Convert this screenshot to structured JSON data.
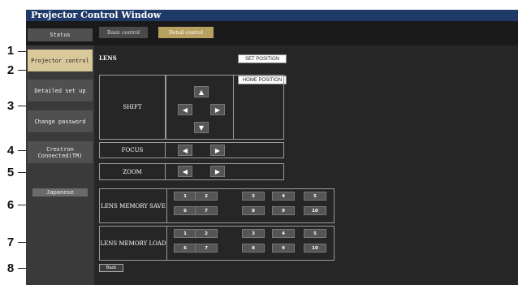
{
  "window": {
    "title": "Projector Control Window"
  },
  "tabs": {
    "basic": "Basic control",
    "detail": "Detail control"
  },
  "sidebar": {
    "items": [
      {
        "label": "Status"
      },
      {
        "label": "Projector control"
      },
      {
        "label": "Detailed set up"
      },
      {
        "label": "Change password"
      },
      {
        "label": "Crestron Connected(TM)"
      },
      {
        "label": "Japanese"
      }
    ]
  },
  "lens": {
    "title": "LENS",
    "set_position": "SET POSITION",
    "home_position": "HOME POSITION",
    "shift_label": "SHIFT",
    "focus_label": "FOCUS",
    "zoom_label": "ZOOM",
    "memory_save_label": "LENS MEMORY SAVE",
    "memory_load_label": "LENS MEMORY LOAD",
    "memory_numbers": [
      "1",
      "2",
      "3",
      "4",
      "5",
      "6",
      "7",
      "8",
      "9",
      "10"
    ],
    "back": "Back"
  },
  "arrows": {
    "up": "▲",
    "down": "▼",
    "left": "◀",
    "right": "▶"
  },
  "callouts": [
    "1",
    "2",
    "3",
    "4",
    "5",
    "6",
    "7",
    "8"
  ]
}
